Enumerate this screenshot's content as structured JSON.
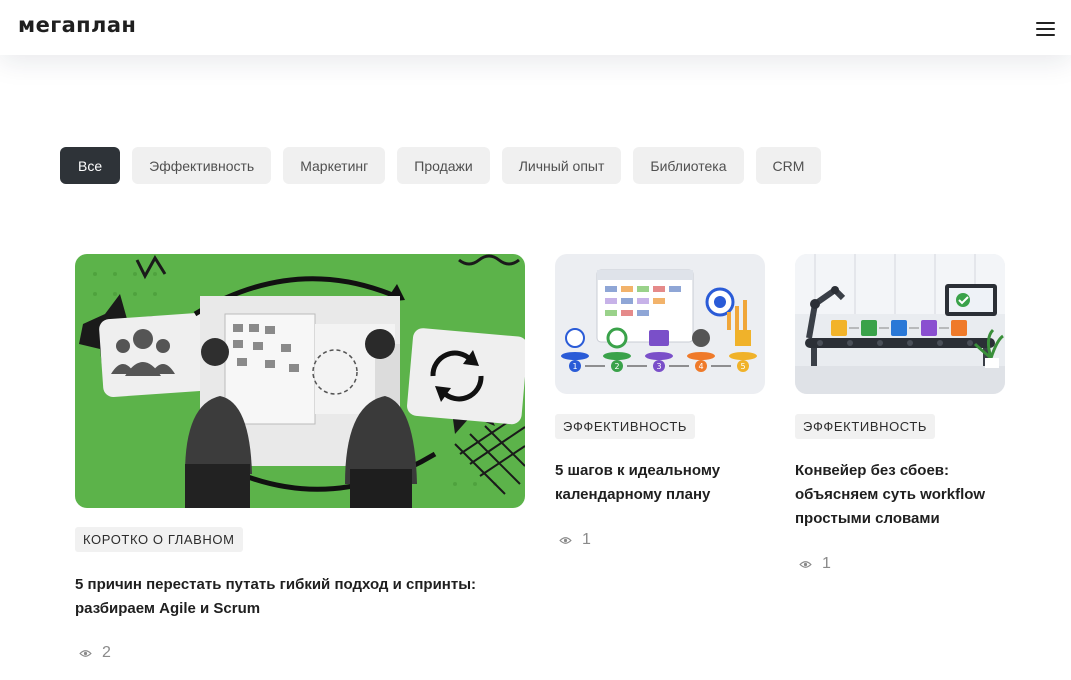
{
  "header": {
    "logo": "мегаплан",
    "menu_icon": "hamburger-icon"
  },
  "filters": [
    {
      "label": "Все",
      "active": true
    },
    {
      "label": "Эффективность",
      "active": false
    },
    {
      "label": "Маркетинг",
      "active": false
    },
    {
      "label": "Продажи",
      "active": false
    },
    {
      "label": "Личный опыт",
      "active": false
    },
    {
      "label": "Библиотека",
      "active": false
    },
    {
      "label": "CRM",
      "active": false
    }
  ],
  "articles": [
    {
      "tag": "КОРОТКО О ГЛАВНОМ",
      "title": "5 причин перестать путать гибкий подход и спринты: разбираем Agile и Scrum",
      "views": "2",
      "icon": "eye-icon"
    },
    {
      "tag": "ЭФФЕКТИВНОСТЬ",
      "title": "5 шагов к идеальному календарному плану",
      "views": "1",
      "icon": "eye-icon",
      "steps": [
        "1",
        "2",
        "3",
        "4",
        "5"
      ]
    },
    {
      "tag": "ЭФФЕКТИВНОСТЬ",
      "title": "Конвейер без сбоев: объясняем суть workflow простыми словами",
      "views": "1",
      "icon": "eye-icon"
    }
  ],
  "colors": {
    "accent_chip": "#2e3338",
    "chip_bg": "#f0f0f0",
    "hero_green": "#5cb34a"
  }
}
